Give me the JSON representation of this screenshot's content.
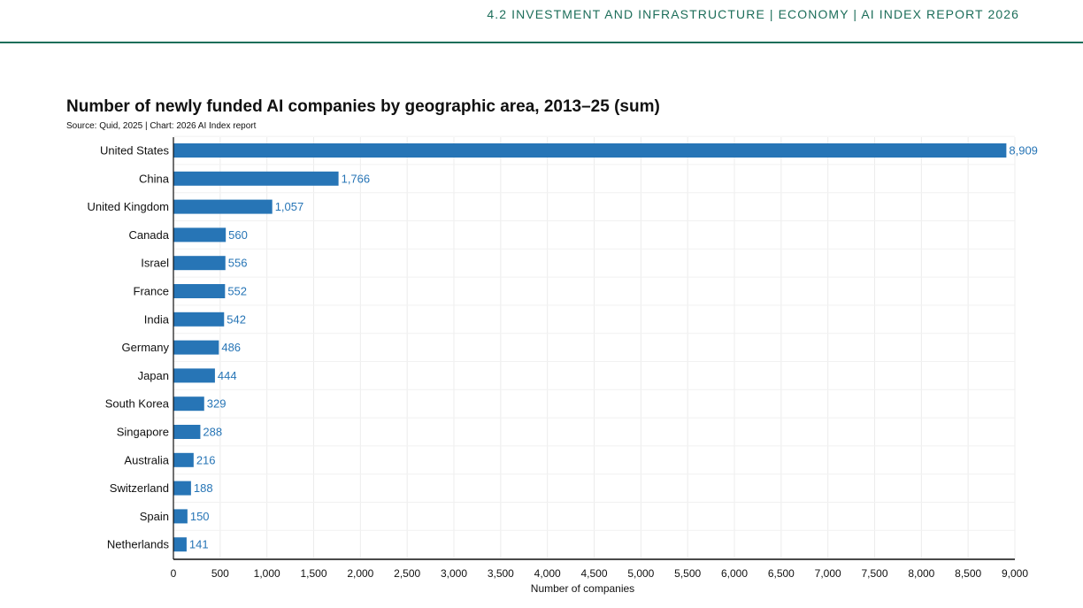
{
  "header": {
    "running_title": "4.2 INVESTMENT AND INFRASTRUCTURE | ECONOMY | AI INDEX REPORT 2026",
    "accent_color": "#1d6e5a"
  },
  "chart_data": {
    "type": "bar",
    "orientation": "horizontal",
    "title": "Number of newly funded AI companies by geographic area, 2013–25 (sum)",
    "source": "Source: Quid, 2025 | Chart: 2026 AI Index report",
    "xlabel": "Number of companies",
    "ylabel": "",
    "xlim": [
      0,
      9000
    ],
    "xticks": [
      0,
      500,
      1000,
      1500,
      2000,
      2500,
      3000,
      3500,
      4000,
      4500,
      5000,
      5500,
      6000,
      6500,
      7000,
      7500,
      8000,
      8500,
      9000
    ],
    "xtick_labels": [
      "0",
      "500",
      "1,000",
      "1,500",
      "2,000",
      "2,500",
      "3,000",
      "3,500",
      "4,000",
      "4,500",
      "5,000",
      "5,500",
      "6,000",
      "6,500",
      "7,000",
      "7,500",
      "8,000",
      "8,500",
      "9,000"
    ],
    "grid": true,
    "bar_color": "#2775b6",
    "label_color": "#2775b6",
    "categories": [
      "United States",
      "China",
      "United Kingdom",
      "Canada",
      "Israel",
      "France",
      "India",
      "Germany",
      "Japan",
      "South Korea",
      "Singapore",
      "Australia",
      "Switzerland",
      "Spain",
      "Netherlands"
    ],
    "values": [
      8909,
      1766,
      1057,
      560,
      556,
      552,
      542,
      486,
      444,
      329,
      288,
      216,
      188,
      150,
      141
    ],
    "value_labels": [
      "8,909",
      "1,766",
      "1,057",
      "560",
      "556",
      "552",
      "542",
      "486",
      "444",
      "329",
      "288",
      "216",
      "188",
      "150",
      "141"
    ]
  }
}
